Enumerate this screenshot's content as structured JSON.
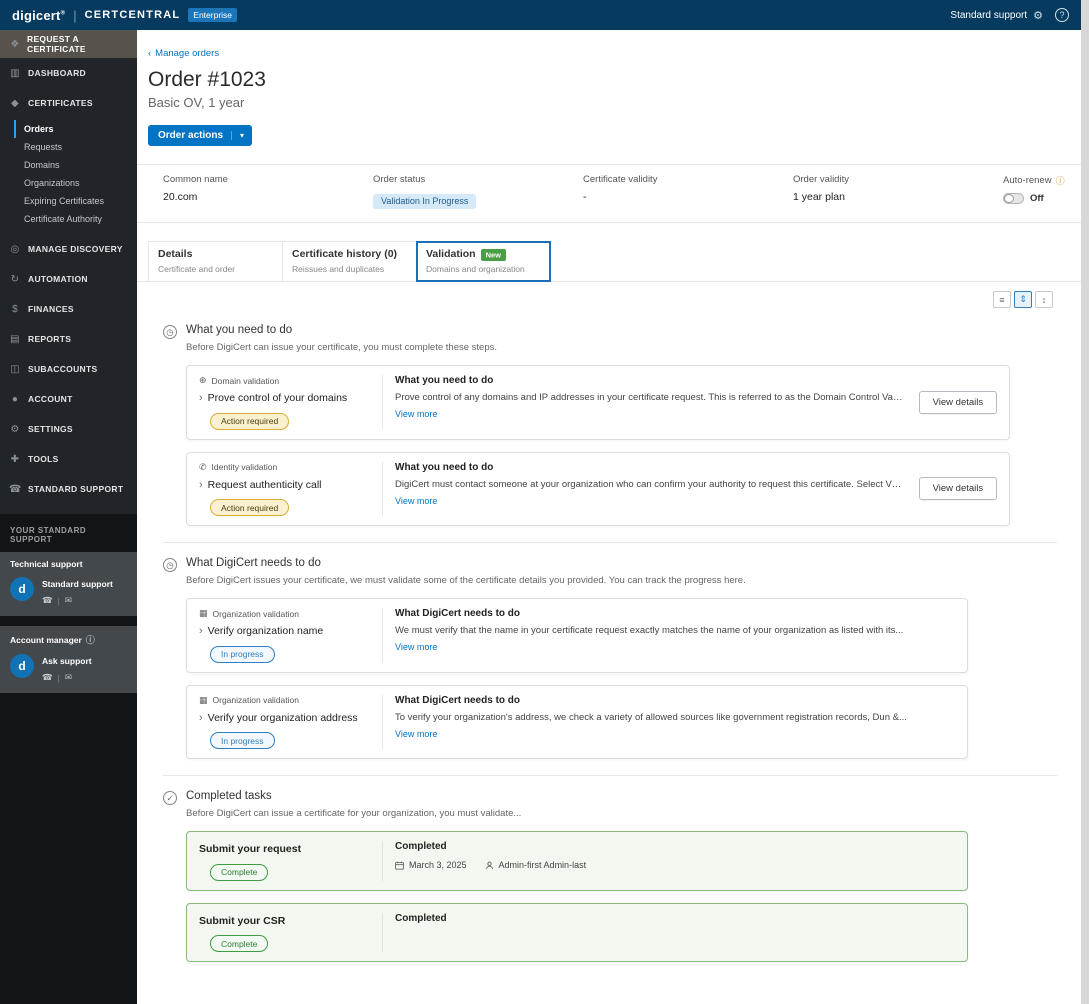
{
  "colors": {
    "brand_blue": "#0174C3",
    "topbar_bg": "#073A5F",
    "sidebar_bg": "#212529",
    "active_subitem_accent": "#2BA3E8",
    "status_pill_bg": "#D6E9F8",
    "action_required_border": "#D9AE33",
    "in_progress_blue": "#2E7FC0",
    "complete_green": "#3F9C3F",
    "done_card_bg": "#F2F8F0"
  },
  "icons": {
    "back": "‹",
    "caret_down": "▾",
    "chevron_right": "›",
    "request_certificate": "❖",
    "dashboard": "▥",
    "certificates": "◆",
    "manage_discovery": "◎",
    "automation": "↻",
    "finances": "$",
    "reports": "▤",
    "subaccounts": "◫",
    "account": "●",
    "settings": "⚙",
    "tools": "✚",
    "standard_support": "☎",
    "headset": "⚙",
    "help": "?",
    "globe": "⊕",
    "phone_call": "✆",
    "organization": "▦",
    "clock": "◷",
    "check": "✓",
    "info": "ⓘ",
    "phone": "☎",
    "mail": "✉",
    "sep": "|",
    "list_view": "≡",
    "collapse_view": "⇕",
    "expand_view": "↕"
  },
  "topbar": {
    "brand": "digicert",
    "brand_mark": "®",
    "divider": "|",
    "product": "CERTCENTRAL",
    "badge": "Enterprise",
    "support_label": "Standard support"
  },
  "sidebar": {
    "request_label": "REQUEST A CERTIFICATE",
    "items": [
      {
        "label": "DASHBOARD"
      },
      {
        "label": "CERTIFICATES"
      },
      {
        "label": "MANAGE DISCOVERY"
      },
      {
        "label": "AUTOMATION"
      },
      {
        "label": "FINANCES"
      },
      {
        "label": "REPORTS"
      },
      {
        "label": "SUBACCOUNTS"
      },
      {
        "label": "ACCOUNT"
      },
      {
        "label": "SETTINGS"
      },
      {
        "label": "TOOLS"
      },
      {
        "label": "STANDARD SUPPORT"
      }
    ],
    "cert_subitems": [
      {
        "label": "Orders",
        "active": true
      },
      {
        "label": "Requests"
      },
      {
        "label": "Domains"
      },
      {
        "label": "Organizations"
      },
      {
        "label": "Expiring Certificates"
      },
      {
        "label": "Certificate Authority"
      }
    ],
    "support_heading": "YOUR STANDARD SUPPORT",
    "technical_support": {
      "title": "Technical support",
      "avatar": "d",
      "label": "Standard support"
    },
    "account_manager": {
      "title": "Account manager",
      "avatar": "d",
      "label": "Ask support"
    }
  },
  "header": {
    "back_link": "Manage orders",
    "title": "Order #1023",
    "subtitle": "Basic OV, 1 year",
    "order_actions": "Order actions"
  },
  "summary": {
    "common_name_label": "Common name",
    "common_name": "20.com",
    "order_status_label": "Order status",
    "order_status": "Validation In Progress",
    "cert_validity_label": "Certificate validity",
    "cert_validity": "-",
    "order_validity_label": "Order validity",
    "order_validity": "1 year plan",
    "auto_renew_label": "Auto-renew",
    "auto_renew_state": "Off"
  },
  "tabs": [
    {
      "label": "Details",
      "sublabel": "Certificate and order"
    },
    {
      "label": "Certificate history (0)",
      "sublabel": "Reissues and duplicates"
    },
    {
      "label": "Validation",
      "badge": "New",
      "sublabel": "Domains and organization",
      "active": true
    }
  ],
  "sections": [
    {
      "title": "What you need to do",
      "subtitle": "Before DigiCert can issue your certificate, you must complete these steps.",
      "cards": [
        {
          "category": "Domain validation",
          "task": "Prove control of your domains",
          "status": "Action required",
          "panel_title": "What you need to do",
          "panel_text": "Prove control of any domains and IP addresses in your certificate request. This is referred to as the Domain Control Validatio...",
          "view_more": "View more",
          "button": "View details"
        },
        {
          "category": "Identity validation",
          "task": "Request authenticity call",
          "status": "Action required",
          "panel_title": "What you need to do",
          "panel_text": "DigiCert must contact someone at your organization who can confirm your authority to request this certificate. Select View...",
          "view_more": "View more",
          "button": "View details"
        }
      ]
    },
    {
      "title": "What DigiCert needs to do",
      "subtitle": "Before DigiCert issues your certificate, we must validate some of the certificate details you provided. You can track the progress here.",
      "cards": [
        {
          "category": "Organization validation",
          "task": "Verify organization name",
          "status": "In progress",
          "panel_title": "What DigiCert needs to do",
          "panel_text": "We must verify that the name in your certificate request exactly matches the name of your organization as listed with its...",
          "view_more": "View more"
        },
        {
          "category": "Organization validation",
          "task": "Verify your organization address",
          "status": "In progress",
          "panel_title": "What DigiCert needs to do",
          "panel_text": "To verify your organization's address, we check a variety of allowed sources like government registration records, Dun &...",
          "view_more": "View more"
        }
      ]
    },
    {
      "title": "Completed tasks",
      "subtitle": "Before DigiCert can issue a certificate for your organization, you must validate...",
      "cards": [
        {
          "task": "Submit your request",
          "status": "Complete",
          "panel_title": "Completed",
          "date": "March 3, 2025",
          "by": "Admin-first Admin-last"
        },
        {
          "task": "Submit your CSR",
          "status": "Complete",
          "panel_title": "Completed"
        }
      ]
    }
  ]
}
